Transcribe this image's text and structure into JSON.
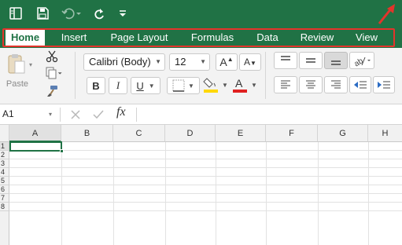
{
  "tabs": [
    "Home",
    "Insert",
    "Page Layout",
    "Formulas",
    "Data",
    "Review",
    "View"
  ],
  "active_tab": "Home",
  "clipboard": {
    "paste_label": "Paste"
  },
  "font": {
    "name": "Calibri (Body)",
    "size": "12"
  },
  "formula_bar": {
    "cell_ref": "A1",
    "fx_label": "fx",
    "value": ""
  },
  "columns": [
    "A",
    "B",
    "C",
    "D",
    "E",
    "F",
    "G",
    "H"
  ],
  "rows": [
    "1",
    "2",
    "3",
    "4",
    "5",
    "6",
    "7",
    "8"
  ],
  "colors": {
    "brand_green": "#207245",
    "highlight": "#e3342b",
    "fill_color_swatch": "#ffd800",
    "font_color_swatch": "#e02020"
  }
}
